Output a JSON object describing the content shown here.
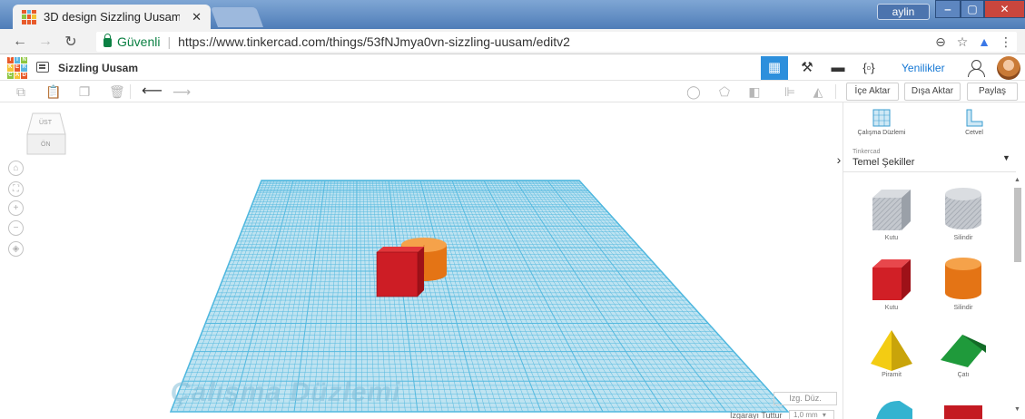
{
  "browser": {
    "tab_title": "3D design Sizzling Uusam",
    "tab_close": "✕",
    "user_label": "aylin",
    "secure_label": "Güvenli",
    "url": "https://www.tinkercad.com/things/53fNJmya0vn-sizzling-uusam/editv2"
  },
  "app": {
    "logo_letters": [
      "T",
      "I",
      "N",
      "K",
      "E",
      "R",
      "C",
      "A",
      "D"
    ],
    "design_title": "Sizzling Uusam",
    "news_label": "Yenilikler"
  },
  "toolbar": {
    "import_label": "İçe Aktar",
    "export_label": "Dışa Aktar",
    "share_label": "Paylaş"
  },
  "canvas": {
    "viewcube_top": "ÜST",
    "viewcube_front": "ÖN",
    "workplane_label": "Çalışma Düzlemi",
    "edit_grid_label": "Izg. Düz.",
    "snap_grid_label": "Izgarayı Tuttur",
    "snap_grid_value": "1,0 mm"
  },
  "panel": {
    "workplane_tool": "Çalışma Düzlemi",
    "ruler_tool": "Cetvel",
    "library_source": "Tinkercad",
    "library_title": "Temel Şekiller",
    "shapes": [
      {
        "label": "Kutu",
        "color": "#b9bec6"
      },
      {
        "label": "Silindir",
        "color": "#c6c9ce"
      },
      {
        "label": "Kutu",
        "color": "#d11f26"
      },
      {
        "label": "Silindir",
        "color": "#ee7d1a"
      },
      {
        "label": "Piramit",
        "color": "#f3cc13"
      },
      {
        "label": "Çatı",
        "color": "#1f9a3b"
      }
    ]
  },
  "colors": {
    "accent": "#2d8fdc",
    "grid_line": "#4bb6de",
    "workplane": "#bfe3f1",
    "box_red": "#d11f26",
    "cylinder_orange": "#ee7d1a"
  }
}
